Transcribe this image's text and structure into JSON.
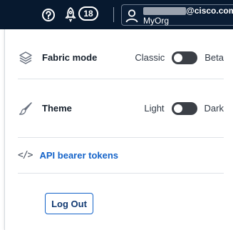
{
  "topbar": {
    "help_icon": "question-circle-icon",
    "notifications_icon": "rocket-icon",
    "notification_count": "18",
    "user_icon": "user-icon",
    "email_suffix": "@cisco.com",
    "org_name": "MyOrg"
  },
  "menu": {
    "fabric_mode": {
      "icon": "layers-icon",
      "label": "Fabric mode",
      "option_left": "Classic",
      "option_right": "Beta",
      "selected": "Classic"
    },
    "theme": {
      "icon": "paintbrush-icon",
      "label": "Theme",
      "option_left": "Light",
      "option_right": "Dark",
      "selected": "Light"
    },
    "api_tokens": {
      "icon": "code-icon",
      "icon_text": "</>",
      "label": "API bearer tokens"
    },
    "logout_label": "Log Out"
  },
  "colors": {
    "topbar_bg": "#07192f",
    "link": "#1463c9",
    "toggle_off": "#3b3f46"
  }
}
